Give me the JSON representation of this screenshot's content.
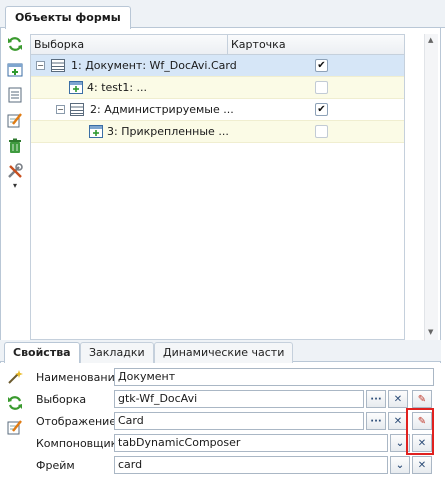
{
  "top_tab": {
    "label": "Объекты формы"
  },
  "grid": {
    "columns": [
      "Выборка",
      "Карточка"
    ],
    "rows": [
      {
        "label": "1: Документ: Wf_DocAvi.Card",
        "checked": true,
        "expander": "−",
        "selected": true
      },
      {
        "label": "4: test1: ...",
        "checked": false,
        "expander": "",
        "selected": false
      },
      {
        "label": "2: Администрируемые ...",
        "checked": true,
        "expander": "−",
        "selected": false
      },
      {
        "label": "3: Прикрепленные ...",
        "checked": false,
        "expander": "",
        "selected": false
      }
    ]
  },
  "check_mark": "✔",
  "bottom_tabs": [
    "Свойства",
    "Закладки",
    "Динамические части"
  ],
  "properties": {
    "name": {
      "label": "Наименование",
      "value": "Документ"
    },
    "selection": {
      "label": "Выборка",
      "value": "gtk-Wf_DocAvi"
    },
    "display": {
      "label": "Отображение",
      "value": "Card"
    },
    "composer": {
      "label": "Компоновщик",
      "value": "tabDynamicComposer"
    },
    "frame": {
      "label": "Фрейм",
      "value": "card"
    }
  },
  "buttons": {
    "ellipsis": "···",
    "clear": "✕",
    "dropdown": "⌄",
    "edit": "✎"
  },
  "colors": {
    "accent": "#3a78c2",
    "highlight_box": "#e0211f",
    "selected_row": "#d6e6f7",
    "alt_row": "#fbfbe6"
  },
  "icons": [
    "refresh-icon",
    "add-selection-icon",
    "list-icon",
    "edit-icon",
    "delete-icon",
    "tools-icon",
    "magic-wand-icon"
  ]
}
